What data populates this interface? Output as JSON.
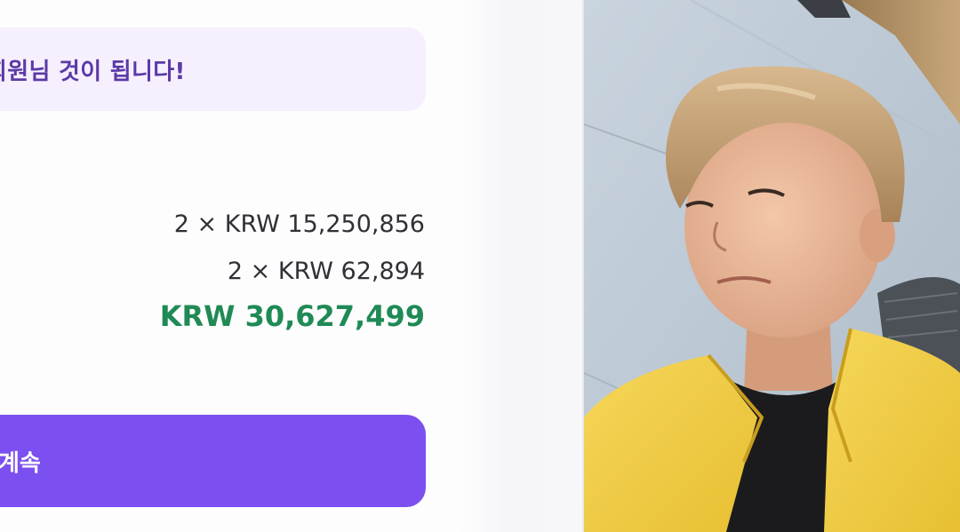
{
  "checkout": {
    "notice": "회원님 것이 됩니다!",
    "line_items": [
      {
        "text": "2 × KRW 15,250,856"
      },
      {
        "text": "2 × KRW 62,894"
      }
    ],
    "total": "KRW 30,627,499",
    "continue_button_label": "계속"
  },
  "colors": {
    "accent_purple": "#7c4ff0",
    "notice_bg": "#f6effd",
    "notice_text": "#5b3aa6",
    "total_green": "#1f8a55"
  },
  "webcam": {
    "subject": "person-in-yellow-jacket"
  }
}
